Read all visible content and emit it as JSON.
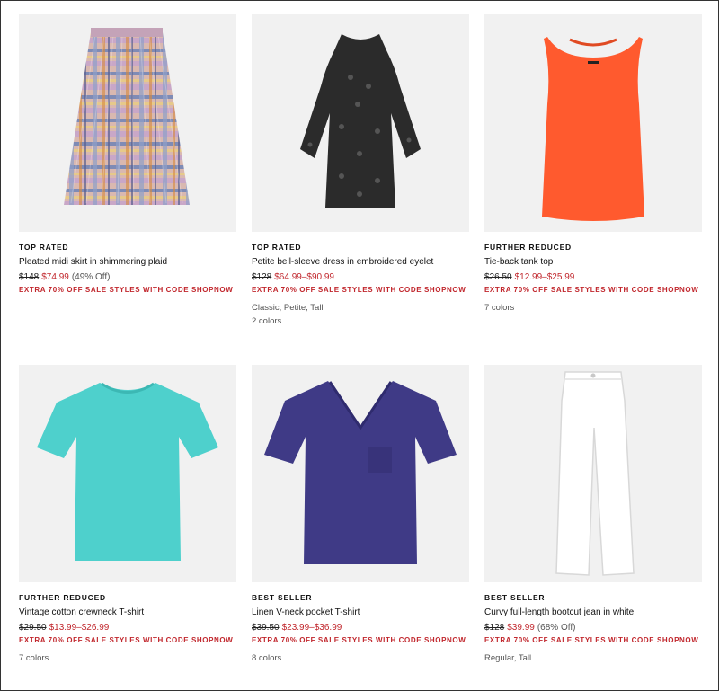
{
  "products": [
    {
      "badge": "TOP RATED",
      "title": "Pleated midi skirt in shimmering plaid",
      "original_price": "$148",
      "sale_price": "$74.99",
      "discount": "(49% Off)",
      "promo": "EXTRA 70% OFF SALE STYLES WITH CODE SHOPNOW",
      "sizes": "",
      "colors": "",
      "image_icon": "plaid-skirt-image"
    },
    {
      "badge": "TOP RATED",
      "title": "Petite bell-sleeve dress in embroidered eyelet",
      "original_price": "$128",
      "sale_price": "$64.99–$90.99",
      "discount": "",
      "promo": "EXTRA 70% OFF SALE STYLES WITH CODE SHOPNOW",
      "sizes": "Classic, Petite, Tall",
      "colors": "2 colors",
      "image_icon": "eyelet-dress-image"
    },
    {
      "badge": "FURTHER REDUCED",
      "title": "Tie-back tank top",
      "original_price": "$26.50",
      "sale_price": "$12.99–$25.99",
      "discount": "",
      "promo": "EXTRA 70% OFF SALE STYLES WITH CODE SHOPNOW",
      "sizes": "",
      "colors": "7 colors",
      "image_icon": "orange-tank-image"
    },
    {
      "badge": "FURTHER REDUCED",
      "title": "Vintage cotton crewneck T-shirt",
      "original_price": "$29.50",
      "sale_price": "$13.99–$26.99",
      "discount": "",
      "promo": "EXTRA 70% OFF SALE STYLES WITH CODE SHOPNOW",
      "sizes": "",
      "colors": "7 colors",
      "image_icon": "teal-tshirt-image"
    },
    {
      "badge": "BEST SELLER",
      "title": "Linen V-neck pocket T-shirt",
      "original_price": "$39.50",
      "sale_price": "$23.99–$36.99",
      "discount": "",
      "promo": "EXTRA 70% OFF SALE STYLES WITH CODE SHOPNOW",
      "sizes": "",
      "colors": "8 colors",
      "image_icon": "navy-vneck-image"
    },
    {
      "badge": "BEST SELLER",
      "title": "Curvy full-length bootcut jean in white",
      "original_price": "$128",
      "sale_price": "$39.99",
      "discount": "(68% Off)",
      "promo": "EXTRA 70% OFF SALE STYLES WITH CODE SHOPNOW",
      "sizes": "Regular, Tall",
      "colors": "",
      "image_icon": "white-jeans-image"
    }
  ],
  "colors": {
    "sale_red": "#c1272d",
    "image_bg": "#f1f1f1",
    "tank_orange": "#ff5a2e",
    "tee_teal": "#4ed0cc",
    "vneck_navy": "#3f3a86"
  }
}
